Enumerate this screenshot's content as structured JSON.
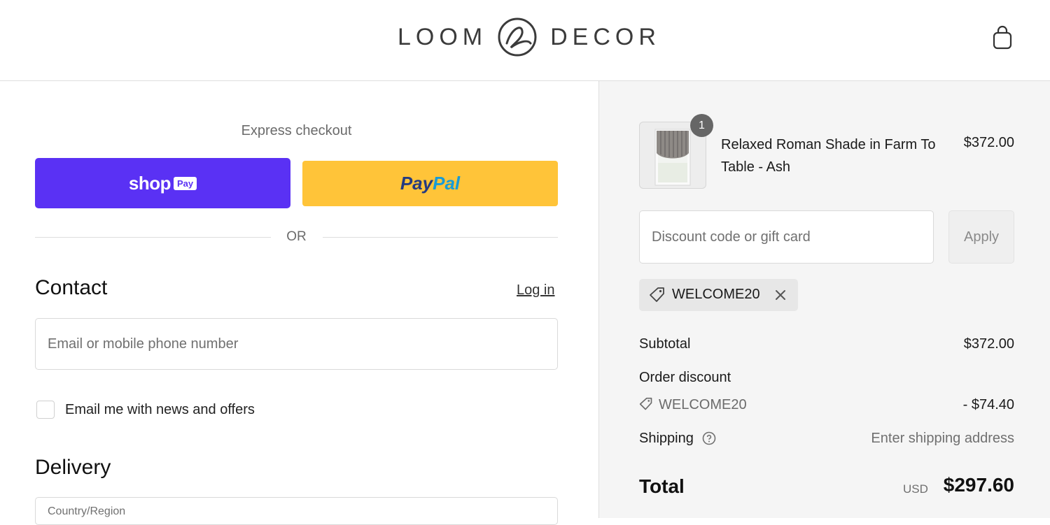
{
  "header": {
    "logo_left": "LOOM",
    "logo_right": "DECOR",
    "cart_icon": "shopping-bag-icon"
  },
  "express": {
    "title": "Express checkout",
    "shoppay_word": "shop",
    "shoppay_badge": "Pay",
    "paypal_part1": "Pay",
    "paypal_part2": "Pal",
    "or_text": "OR"
  },
  "contact": {
    "heading": "Contact",
    "login_label": "Log in",
    "email_placeholder": "Email or mobile phone number",
    "news_label": "Email me with news and offers"
  },
  "delivery": {
    "heading": "Delivery",
    "country_label": "Country/Region"
  },
  "summary": {
    "product": {
      "quantity": "1",
      "name": "Relaxed Roman Shade in Farm To Table - Ash",
      "price": "$372.00"
    },
    "discount_placeholder": "Discount code or gift card",
    "apply_label": "Apply",
    "applied_code": "WELCOME20",
    "subtotal_label": "Subtotal",
    "subtotal_value": "$372.00",
    "order_discount_label": "Order discount",
    "discount_code": "WELCOME20",
    "discount_value": "- $74.40",
    "shipping_label": "Shipping",
    "shipping_value": "Enter shipping address",
    "total_label": "Total",
    "currency": "USD",
    "total_value": "$297.60"
  },
  "colors": {
    "shoppay": "#5a31f4",
    "paypal": "#ffc439",
    "summary_bg": "#f5f5f5"
  }
}
